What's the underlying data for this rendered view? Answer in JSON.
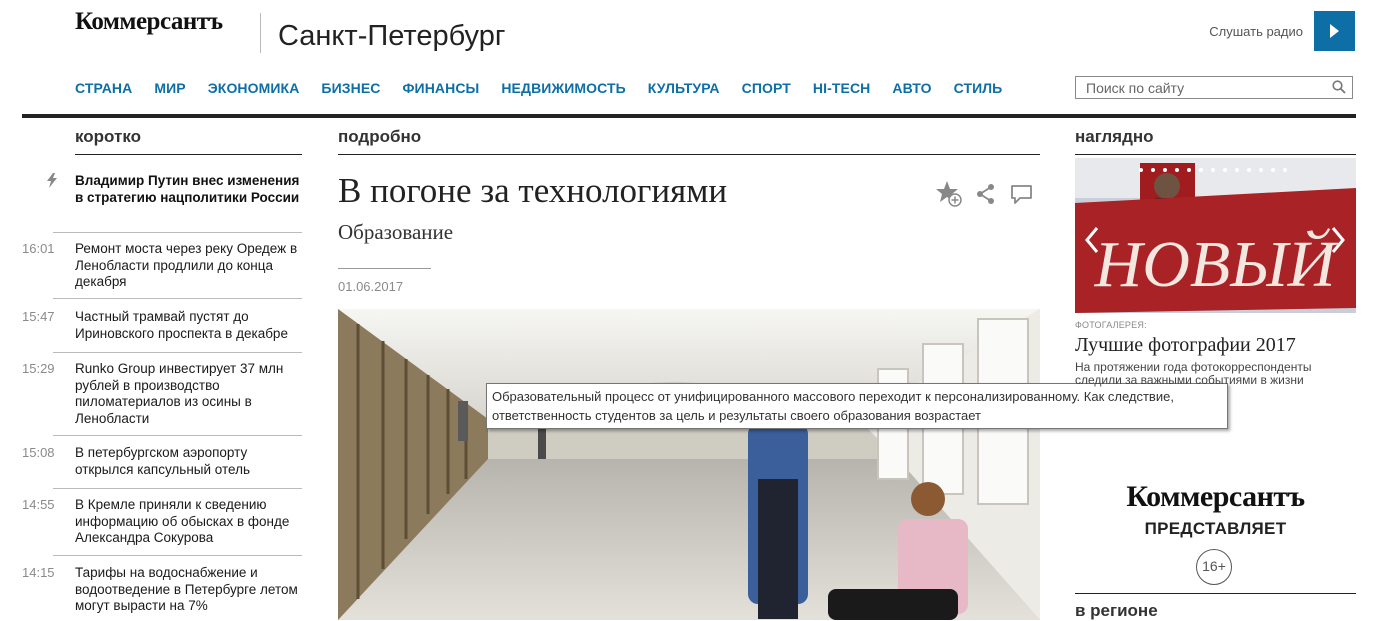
{
  "header": {
    "logo": "Коммерсантъ",
    "city": "Санкт-Петербург",
    "radio_label": "Слушать радио"
  },
  "nav": [
    "СТРАНА",
    "МИР",
    "ЭКОНОМИКА",
    "БИЗНЕС",
    "ФИНАНСЫ",
    "НЕДВИЖИМОСТЬ",
    "КУЛЬТУРА",
    "СПОРТ",
    "HI-TECH",
    "АВТО",
    "СТИЛЬ"
  ],
  "search": {
    "placeholder": "Поиск по сайту"
  },
  "sections": {
    "left": "коротко",
    "center": "подробно",
    "right": "наглядно",
    "region": "в регионе"
  },
  "news": {
    "featured": "Владимир Путин внес изменения в стратегию нацполитики России",
    "items": [
      {
        "time": "16:01",
        "text": "Ремонт моста через реку Оредеж в Ленобласти продлили до конца декабря"
      },
      {
        "time": "15:47",
        "text": "Частный трамвай пустят до Ириновского проспекта в декабре"
      },
      {
        "time": "15:29",
        "text": "Runko Group инвестирует 37 млн рублей в производство пиломатериалов из осины в Ленобласти"
      },
      {
        "time": "15:08",
        "text": "В петербургском аэропорту открылся капсульный отель"
      },
      {
        "time": "14:55",
        "text": "В Кремле приняли к сведению информацию об обысках в фонде Александра Сокурова"
      },
      {
        "time": "14:15",
        "text": "Тарифы на водоснабжение и водоотведение в Петербурге летом могут вырасти на 7%"
      }
    ]
  },
  "article": {
    "title": "В погоне за технологиями",
    "rubric": "Образование",
    "date": "01.06.2017",
    "tooltip": "Образовательный процесс от унифицированного массового переходит к персонализированному. Как следствие, ответственность студентов за цель и результаты своего образования возрастает"
  },
  "gallery": {
    "banner_text": "НОВЫЙ",
    "label": "ФОТОГАЛЕРЕЯ:",
    "title": "Лучшие фотографии 2017",
    "desc": "На протяжении года фотокорреспонденты следили за важными событиями в жизни"
  },
  "promo": {
    "logo": "Коммерсантъ",
    "sub": "ПРЕДСТАВЛЯЕТ",
    "age": "16+"
  },
  "colors": {
    "accent": "#0e6ea6",
    "text": "#222222",
    "muted": "#8a8a8a"
  }
}
